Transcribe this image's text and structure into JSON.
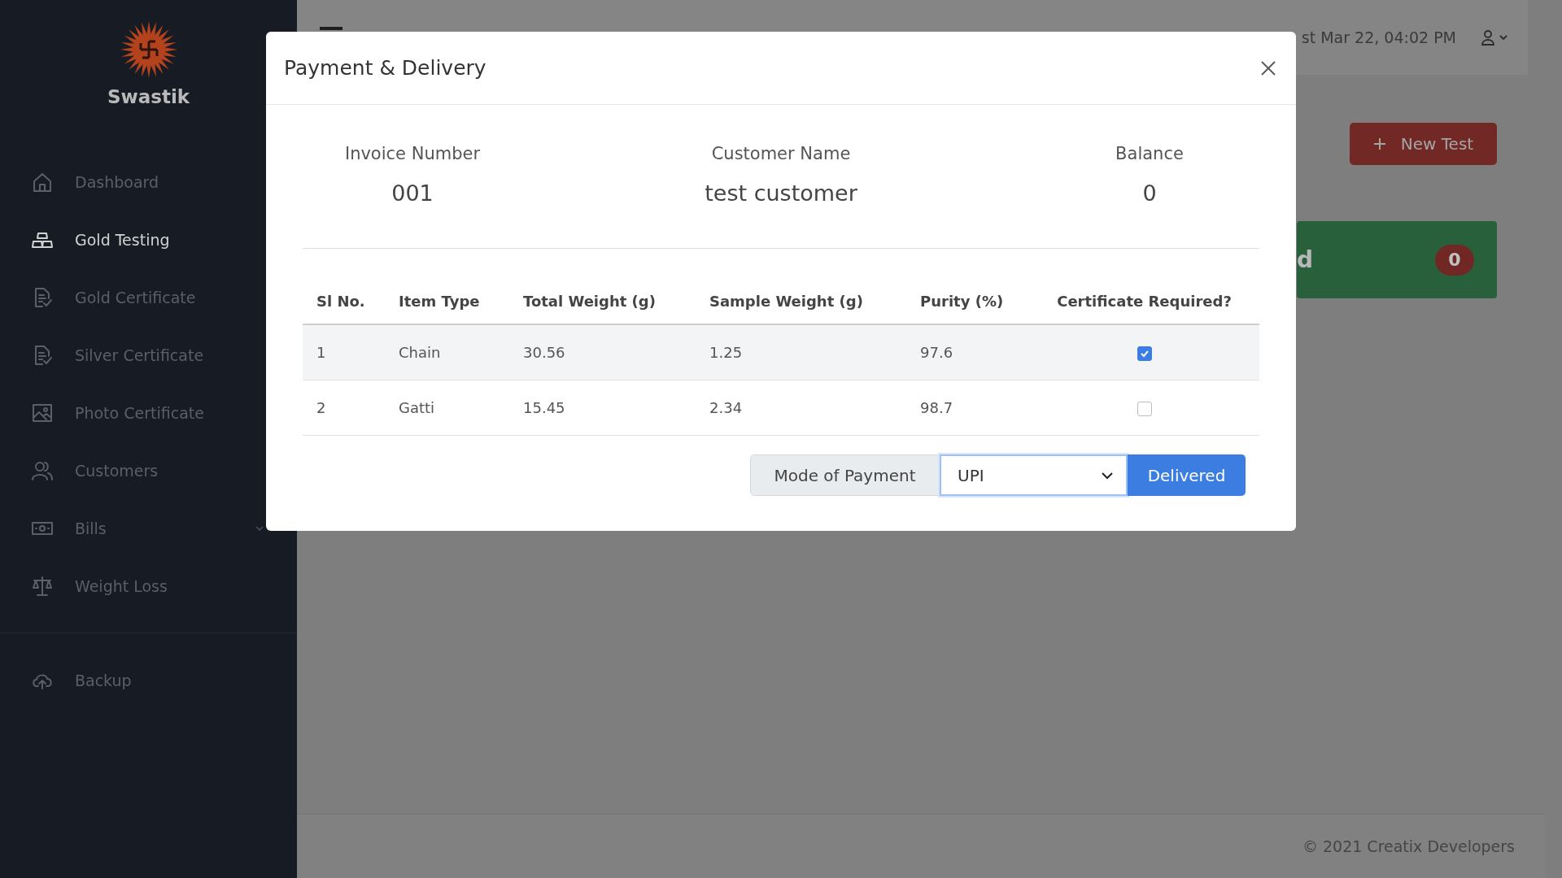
{
  "sidebar": {
    "brand": "Swastik",
    "items": [
      {
        "label": "Dashboard",
        "selected": false
      },
      {
        "label": "Gold Testing",
        "selected": true
      },
      {
        "label": "Gold Certificate",
        "selected": false
      },
      {
        "label": "Silver Certificate",
        "selected": false
      },
      {
        "label": "Photo Certificate",
        "selected": false
      },
      {
        "label": "Customers",
        "selected": false
      },
      {
        "label": "Bills",
        "selected": false,
        "expanded": false
      },
      {
        "label": "Weight Loss",
        "selected": false
      }
    ],
    "bottom_items": [
      {
        "label": "Backup",
        "selected": false
      }
    ]
  },
  "topbar": {
    "datetime": "st Mar 22, 04:02 PM"
  },
  "new_button": "New Test",
  "stat_card": {
    "label": "d",
    "count": "0"
  },
  "footer": {
    "copyright": "© 2021 Creatix Developers"
  },
  "modal": {
    "title": "Payment & Delivery",
    "summary": [
      {
        "label": "Invoice Number",
        "value": "001"
      },
      {
        "label": "Customer Name",
        "value": "test customer"
      },
      {
        "label": "Balance",
        "value": "0"
      }
    ],
    "table": {
      "columns": [
        "Sl No.",
        "Item Type",
        "Total Weight (g)",
        "Sample Weight (g)",
        "Purity (%)",
        "Certificate Required?"
      ],
      "rows": [
        {
          "sl_no": "1",
          "item_type": "Chain",
          "total_weight": "30.56",
          "sample_weight": "1.25",
          "purity": "97.6",
          "certificate_required": true
        },
        {
          "sl_no": "2",
          "item_type": "Gatti",
          "total_weight": "15.45",
          "sample_weight": "2.34",
          "purity": "98.7",
          "certificate_required": false
        }
      ]
    },
    "payment": {
      "label": "Mode of Payment",
      "value": "UPI",
      "button": "Delivered"
    }
  }
}
